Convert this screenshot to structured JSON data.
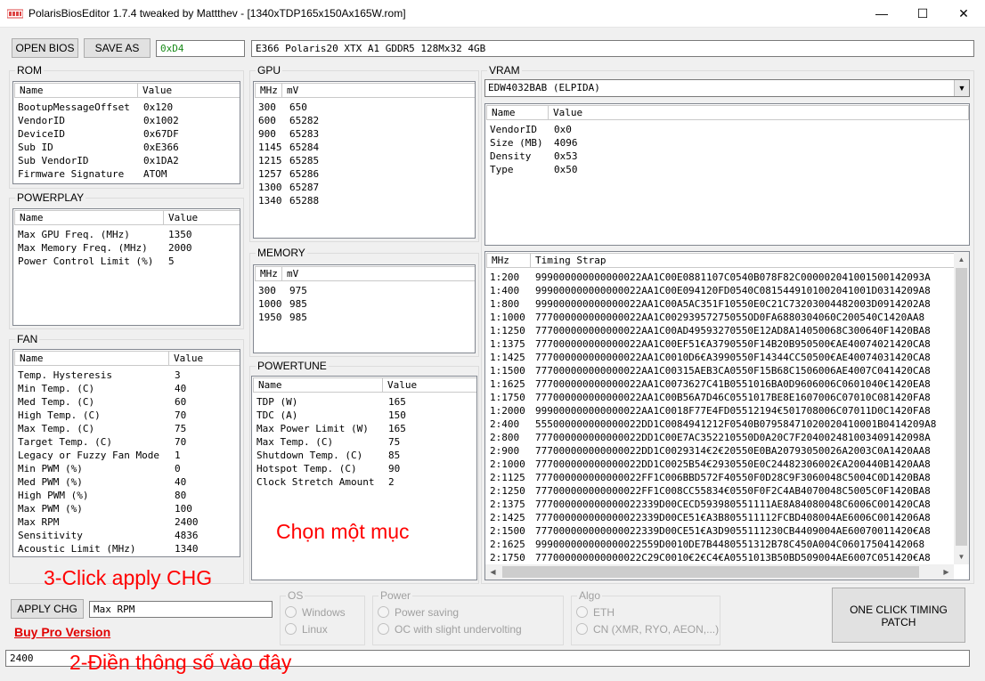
{
  "window": {
    "title": "PolarisBiosEditor 1.7.4 tweaked by Mattthev  - [1340xTDP165x150Ax165W.rom]",
    "minimize": "—",
    "maximize": "☐",
    "close": "✕"
  },
  "toolbar": {
    "open_bios": "OPEN BIOS",
    "save_as": "SAVE AS",
    "checksum": "0xD4",
    "bios_name": "E366 Polaris20 XTX A1 GDDR5 128Mx32 4GB"
  },
  "rom": {
    "legend": "ROM",
    "col_name": "Name",
    "col_value": "Value",
    "rows": [
      {
        "name": "BootupMessageOffset",
        "value": "0x120"
      },
      {
        "name": "VendorID",
        "value": "0x1002"
      },
      {
        "name": "DeviceID",
        "value": "0x67DF"
      },
      {
        "name": "Sub ID",
        "value": "0xE366"
      },
      {
        "name": "Sub VendorID",
        "value": "0x1DA2"
      },
      {
        "name": "Firmware Signature",
        "value": "ATOM"
      }
    ]
  },
  "powerplay": {
    "legend": "POWERPLAY",
    "col_name": "Name",
    "col_value": "Value",
    "rows": [
      {
        "name": "Max GPU Freq. (MHz)",
        "value": "1350"
      },
      {
        "name": "Max Memory Freq. (MHz)",
        "value": "2000"
      },
      {
        "name": "Power Control Limit (%)",
        "value": "5"
      }
    ]
  },
  "fan": {
    "legend": "FAN",
    "col_name": "Name",
    "col_value": "Value",
    "rows": [
      {
        "name": "Temp. Hysteresis",
        "value": "3"
      },
      {
        "name": "Min Temp. (C)",
        "value": "40"
      },
      {
        "name": "Med Temp. (C)",
        "value": "60"
      },
      {
        "name": "High Temp. (C)",
        "value": "70"
      },
      {
        "name": "Max Temp. (C)",
        "value": "75"
      },
      {
        "name": "Target Temp. (C)",
        "value": "70"
      },
      {
        "name": "Legacy or Fuzzy Fan Mode",
        "value": "1"
      },
      {
        "name": "Min PWM (%)",
        "value": "0"
      },
      {
        "name": "Med PWM (%)",
        "value": "40"
      },
      {
        "name": "High PWM (%)",
        "value": "80"
      },
      {
        "name": "Max PWM (%)",
        "value": "100"
      },
      {
        "name": "Max RPM",
        "value": "2400"
      },
      {
        "name": "Sensitivity",
        "value": "4836"
      },
      {
        "name": "Acoustic Limit (MHz)",
        "value": "1340"
      }
    ]
  },
  "gpu": {
    "legend": "GPU",
    "col_mhz": "MHz",
    "col_mv": "mV",
    "rows": [
      {
        "mhz": "300",
        "mv": "650"
      },
      {
        "mhz": "600",
        "mv": "65282"
      },
      {
        "mhz": "900",
        "mv": "65283"
      },
      {
        "mhz": "1145",
        "mv": "65284"
      },
      {
        "mhz": "1215",
        "mv": "65285"
      },
      {
        "mhz": "1257",
        "mv": "65286"
      },
      {
        "mhz": "1300",
        "mv": "65287"
      },
      {
        "mhz": "1340",
        "mv": "65288"
      }
    ]
  },
  "memory": {
    "legend": "MEMORY",
    "col_mhz": "MHz",
    "col_mv": "mV",
    "rows": [
      {
        "mhz": "300",
        "mv": "975"
      },
      {
        "mhz": "1000",
        "mv": "985"
      },
      {
        "mhz": "1950",
        "mv": "985"
      }
    ]
  },
  "powertune": {
    "legend": "POWERTUNE",
    "col_name": "Name",
    "col_value": "Value",
    "rows": [
      {
        "name": "TDP (W)",
        "value": "165"
      },
      {
        "name": "TDC (A)",
        "value": "150"
      },
      {
        "name": "Max Power Limit (W)",
        "value": "165"
      },
      {
        "name": "Max Temp. (C)",
        "value": "75"
      },
      {
        "name": "Shutdown Temp. (C)",
        "value": "85"
      },
      {
        "name": "Hotspot Temp. (C)",
        "value": "90"
      },
      {
        "name": "Clock Stretch Amount",
        "value": "2"
      }
    ]
  },
  "vram": {
    "legend": "VRAM",
    "selected": "EDW4032BAB (ELPIDA)",
    "dropdown_arrow": "▼",
    "col_name": "Name",
    "col_value": "Value",
    "rows": [
      {
        "name": "VendorID",
        "value": "0x0"
      },
      {
        "name": "Size (MB)",
        "value": "4096"
      },
      {
        "name": "Density",
        "value": "0x53"
      },
      {
        "name": "Type",
        "value": "0x50"
      }
    ]
  },
  "timing": {
    "col_mhz": "MHz",
    "col_strap": "Timing Strap",
    "scroll_up": "▲",
    "scroll_down": "▼",
    "scroll_left": "◀",
    "scroll_right": "▶",
    "rows": [
      {
        "mhz": "1:200",
        "strap": "999000000000000022AA1C00E0881107C0540B078F82C000002041001500142093A"
      },
      {
        "mhz": "1:400",
        "strap": "999000000000000022AA1C00E094120FD0540C0815449101002041001D0314209A8"
      },
      {
        "mhz": "1:800",
        "strap": "999000000000000022AA1C00A5AC351F10550E0C21C73203004482003D0914202A8"
      },
      {
        "mhz": "1:1000",
        "strap": "777000000000000022AA1C00293957275055OD0FA6880304060C200540C1420AA8"
      },
      {
        "mhz": "1:1250",
        "strap": "777000000000000022AA1C00AD49593270550E12AD8A14050068C300640F1420BA8"
      },
      {
        "mhz": "1:1375",
        "strap": "777000000000000022AA1C00EF51€A3790550F14B20B950500€AE40074021420CA8"
      },
      {
        "mhz": "1:1425",
        "strap": "777000000000000022AA1C0010D6€A3990550F14344CC50500€AE40074031420CA8"
      },
      {
        "mhz": "1:1500",
        "strap": "777000000000000022AA1C00315AEB3CA0550F15B68C1506006AE4007C041420CA8"
      },
      {
        "mhz": "1:1625",
        "strap": "777000000000000022AA1C0073627C41B0551016BA0D9606006C0601040€1420EA8"
      },
      {
        "mhz": "1:1750",
        "strap": "777000000000000022AA1C00B56A7D46C0551017BE8E1607006C07010C081420FA8"
      },
      {
        "mhz": "1:2000",
        "strap": "999000000000000022AA1C0018F77E4FD05512194€501708006C07011D0C1420FA8"
      },
      {
        "mhz": "2:400",
        "strap": "555000000000000022DD1C0084941212F0540B07958471020020410001B0414209A8"
      },
      {
        "mhz": "2:800",
        "strap": "777000000000000022DD1C00E7AC352210550D0A20C7F204002481003409142098A"
      },
      {
        "mhz": "2:900",
        "strap": "777000000000000022DD1C0029314€2€20550E0BA20793050026A2003C0A1420AA8"
      },
      {
        "mhz": "2:1000",
        "strap": "777000000000000022DD1C0025B54€2930550E0C24482306002€A200440B1420AA8"
      },
      {
        "mhz": "2:1125",
        "strap": "777000000000000022FF1C006BBD572F40550F0D28C9F3060048C5004C0D1420BA8"
      },
      {
        "mhz": "2:1250",
        "strap": "777000000000000022FF1C008CC55834€0550F0F2C4AB4070048C5005C0F1420BA8"
      },
      {
        "mhz": "2:1375",
        "strap": "777000000000000022339D00CECD593980551111AE8A84080048C6006C001420CA8"
      },
      {
        "mhz": "2:1425",
        "strap": "777000000000000022339D00CE51€A3B805511112FCBD408004AE6006C0014206A8"
      },
      {
        "mhz": "2:1500",
        "strap": "777000000000000022339D00CE51€A3D9055111230CB4409004AE60070011420€A8"
      },
      {
        "mhz": "2:1625",
        "strap": "999000000000000022559D0010DE7B4480551312B78C450A004C06017504142068"
      },
      {
        "mhz": "2:1750",
        "strap": "777000000000000022C29C0010€2€C4€A0551013B50BD509004AE6007C051420€A8"
      }
    ]
  },
  "apply": {
    "button": "APPLY CHG",
    "field_name": "Max RPM",
    "buy_pro": "Buy Pro Version",
    "value_input": "2400"
  },
  "os_group": {
    "legend": "OS",
    "options": [
      "Windows",
      "Linux"
    ]
  },
  "power_group": {
    "legend": "Power",
    "options": [
      "Power saving",
      "OC with slight undervolting"
    ]
  },
  "algo_group": {
    "legend": "Algo",
    "options": [
      "ETH",
      "CN (XMR, RYO, AEON,...)"
    ]
  },
  "one_click": {
    "line1": "ONE CLICK TIMING",
    "line2": "PATCH"
  },
  "annotations": {
    "select_item": "Chọn một mục",
    "click_apply": "3-Click apply CHG",
    "fill_value": "2-Điền thông số vào đây"
  }
}
